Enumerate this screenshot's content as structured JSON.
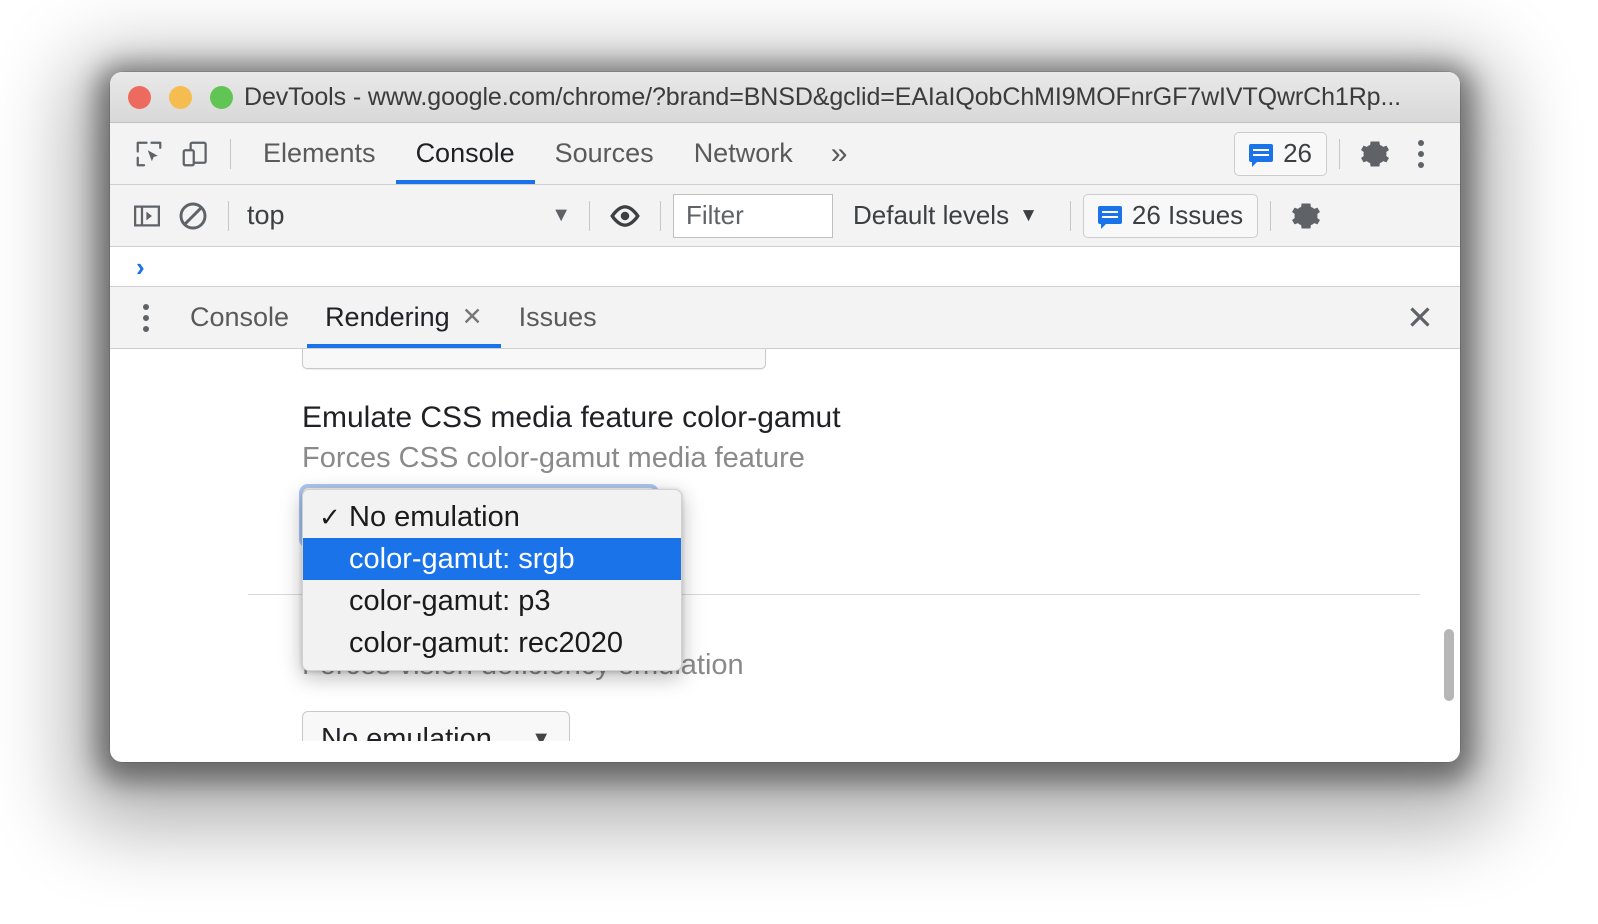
{
  "window": {
    "title": "DevTools - www.google.com/chrome/?brand=BNSD&gclid=EAIaIQobChMI9MOFnrGF7wIVTQwrCh1Rp...",
    "traffic_lights": {
      "close_color": "#ED6A5E",
      "minimize_color": "#F5BD4F",
      "zoom_color": "#61C555"
    }
  },
  "main_toolbar": {
    "inspect_icon": "inspect-element-icon",
    "device_icon": "device-toolbar-icon",
    "tabs": [
      {
        "label": "Elements",
        "active": false
      },
      {
        "label": "Console",
        "active": true
      },
      {
        "label": "Sources",
        "active": false
      },
      {
        "label": "Network",
        "active": false
      }
    ],
    "more_tabs": "»",
    "issues_count": "26",
    "settings_icon": "gear-icon",
    "more_options_icon": "kebab-menu-icon"
  },
  "console_toolbar": {
    "sidebar_icon": "console-sidebar-icon",
    "clear_icon": "clear-console-icon",
    "context": "top",
    "context_caret": "▼",
    "eye_icon": "live-expression-icon",
    "filter_placeholder": "Filter",
    "filter_value": "",
    "levels_label": "Default levels",
    "levels_caret": "▼",
    "issues_label": "26 Issues",
    "settings_icon": "gear-icon"
  },
  "console_prompt": {
    "arrow": "›"
  },
  "drawer": {
    "kebab_icon": "drawer-more-icon",
    "tabs": [
      {
        "label": "Console",
        "active": false,
        "closable": false
      },
      {
        "label": "Rendering",
        "active": true,
        "closable": true,
        "close_glyph": "✕"
      },
      {
        "label": "Issues",
        "active": false,
        "closable": false
      }
    ],
    "close_glyph": "✕"
  },
  "rendering_panel": {
    "color_gamut": {
      "title": "Emulate CSS media feature color-gamut",
      "subtitle": "Forces CSS color-gamut media feature",
      "selected_value": "No emulation"
    },
    "vision_deficiency": {
      "subtitle": "Forces vision deficiency emulation",
      "selected_value": "No emulation",
      "caret": "▼"
    },
    "open_dropdown": {
      "check_glyph": "✓",
      "options": [
        {
          "label": "No emulation",
          "checked": true,
          "highlighted": false
        },
        {
          "label": "color-gamut: srgb",
          "checked": false,
          "highlighted": true
        },
        {
          "label": "color-gamut: p3",
          "checked": false,
          "highlighted": false
        },
        {
          "label": "color-gamut: rec2020",
          "checked": false,
          "highlighted": false
        }
      ]
    }
  },
  "colors": {
    "accent": "#1a73e8",
    "highlight": "#1a73e8",
    "toolbar_bg": "#f3f3f3",
    "panel_bg": "#ffffff"
  }
}
